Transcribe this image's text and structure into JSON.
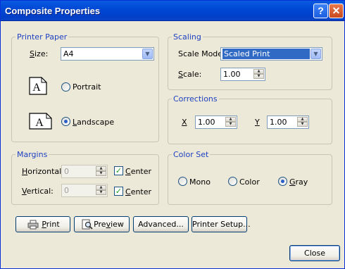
{
  "window": {
    "title": "Composite Properties"
  },
  "titlebar": {
    "help_glyph": "?",
    "close_glyph": "✕"
  },
  "printer_paper": {
    "legend": "Printer Paper",
    "size_label": "Size:",
    "size_value": "A4",
    "portrait_label": "Portrait",
    "landscape_label": "Landscape",
    "orientation_selected": "Landscape",
    "icon_glyph": "A"
  },
  "scaling": {
    "legend": "Scaling",
    "scale_mode_label": "Scale Mode",
    "scale_mode_value": "Scaled Print",
    "scale_label": "Scale:",
    "scale_value": "1.00"
  },
  "corrections": {
    "legend": "Corrections",
    "x_label": "X",
    "x_value": "1.00",
    "y_label": "Y",
    "y_value": "1.00"
  },
  "margins": {
    "legend": "Margins",
    "horizontal_label": "Horizontal:",
    "horizontal_value": "0",
    "vertical_label": "Vertical:",
    "vertical_value": "0",
    "center_label": "Center",
    "horizontal_center_checked": true,
    "vertical_center_checked": true
  },
  "color_set": {
    "legend": "Color Set",
    "options": [
      "Mono",
      "Color",
      "Gray"
    ],
    "selected": "Gray"
  },
  "buttons": {
    "print": "Print",
    "preview": "Preview",
    "advanced": "Advanced...",
    "printer_setup": "Printer Setup...",
    "close": "Close"
  },
  "colors": {
    "titlebar": "#0049d6",
    "dialog_bg": "#ece9d8",
    "group_legend": "#1e40c0",
    "selection": "#316ac5"
  }
}
